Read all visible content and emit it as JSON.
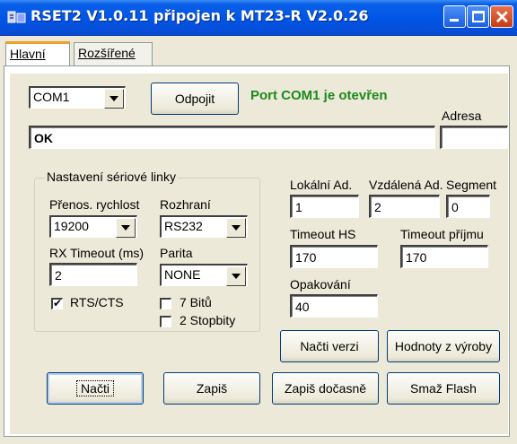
{
  "window": {
    "title": "RSET2 V1.0.11 připojen k MT23-R V2.0.26"
  },
  "tabs": [
    {
      "label": "Hlavní"
    },
    {
      "label": "Rozšířené"
    }
  ],
  "port": {
    "selected": "COM1",
    "disconnect_label": "Odpojit",
    "status": "Port COM1 je otevřen"
  },
  "address": {
    "label": "Adresa",
    "value": ""
  },
  "response": {
    "value": "OK"
  },
  "serial": {
    "group_title": "Nastavení sériové linky",
    "speed_label": "Přenos. rychlost",
    "speed_value": "19200",
    "interface_label": "Rozhraní",
    "interface_value": "RS232",
    "rx_timeout_label": "RX Timeout (ms)",
    "rx_timeout_value": "2",
    "parity_label": "Parita",
    "parity_value": "NONE",
    "rts_label": "RTS/CTS",
    "rts_checked": true,
    "bits7_label": "7 Bitů",
    "bits7_checked": false,
    "stopbits_label": "2 Stopbity",
    "stopbits_checked": false
  },
  "device": {
    "local_label": "Lokální Ad.",
    "local_value": "1",
    "remote_label": "Vzdálená Ad.",
    "remote_value": "2",
    "segment_label": "Segment",
    "segment_value": "0",
    "timeout_hs_label": "Timeout HS",
    "timeout_hs_value": "170",
    "timeout_rx_label": "Timeout příjmu",
    "timeout_rx_value": "170",
    "retries_label": "Opakování",
    "retries_value": "40"
  },
  "buttons": {
    "read_version": "Načti verzi",
    "factory_values": "Hodnoty z výroby",
    "read": "Načti",
    "write": "Zapiš",
    "write_temp": "Zapiš dočasně",
    "erase_flash": "Smaž Flash"
  }
}
